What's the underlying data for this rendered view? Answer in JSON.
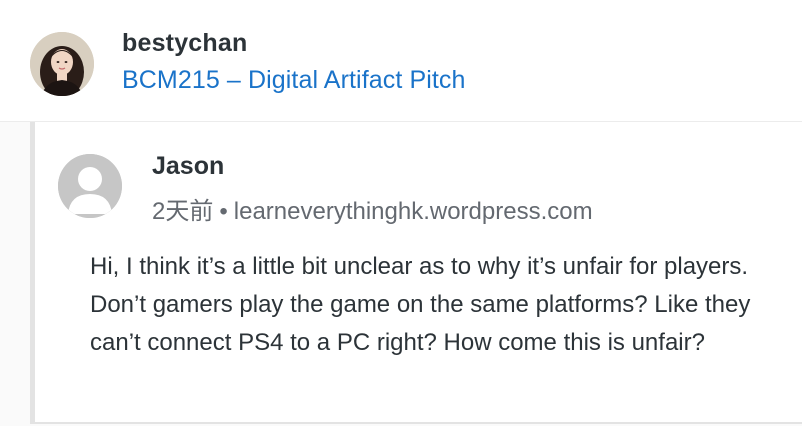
{
  "post": {
    "author": "bestychan",
    "title": "BCM215 – Digital Artifact Pitch"
  },
  "comment": {
    "author": "Jason",
    "time": "2天前",
    "separator": "•",
    "site": "learneverythinghk.wordpress.com",
    "body": "Hi, I think it’s a little bit unclear as to why it’s unfair for players. Don’t gamers play the game on the same platforms? Like they can’t connect PS4 to a PC right? How come this is unfair?"
  },
  "colors": {
    "link": "#1a73c9",
    "text": "#2c3338",
    "muted": "#646970"
  },
  "icons": {
    "author_avatar": "profile-photo",
    "commenter_avatar": "default-user-icon"
  }
}
